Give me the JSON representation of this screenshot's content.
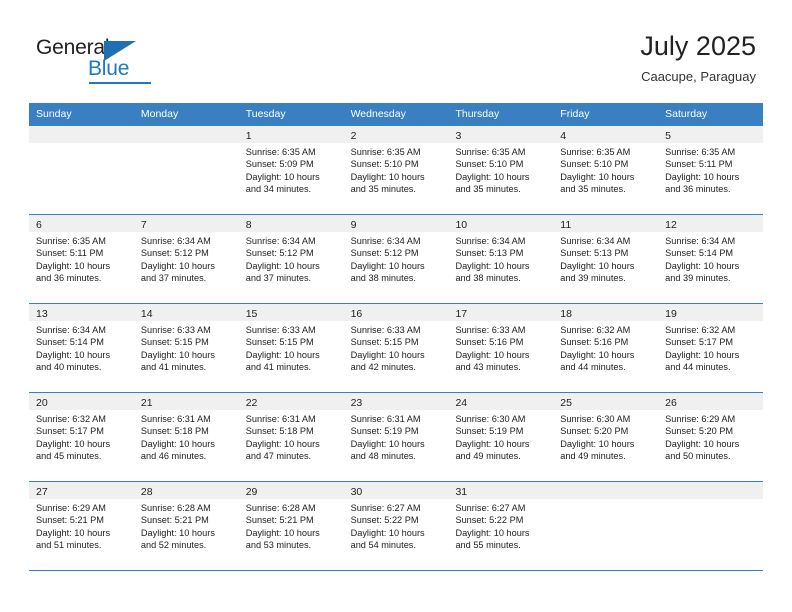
{
  "brand": {
    "name_part1": "General",
    "name_part2": "Blue",
    "triangle_icon": "triangle-icon",
    "accent_color": "#1f78c1"
  },
  "header": {
    "title": "July 2025",
    "subtitle": "Caacupe, Paraguay"
  },
  "calendar": {
    "header_bg": "#3a7fc1",
    "day_strip_bg": "#f0f0f0",
    "weekdays": [
      "Sunday",
      "Monday",
      "Tuesday",
      "Wednesday",
      "Thursday",
      "Friday",
      "Saturday"
    ],
    "weeks": [
      [
        {
          "day": "",
          "sunrise": "",
          "sunset": "",
          "daylight_line1": "",
          "daylight_line2": ""
        },
        {
          "day": "",
          "sunrise": "",
          "sunset": "",
          "daylight_line1": "",
          "daylight_line2": ""
        },
        {
          "day": "1",
          "sunrise": "Sunrise: 6:35 AM",
          "sunset": "Sunset: 5:09 PM",
          "daylight_line1": "Daylight: 10 hours",
          "daylight_line2": "and 34 minutes."
        },
        {
          "day": "2",
          "sunrise": "Sunrise: 6:35 AM",
          "sunset": "Sunset: 5:10 PM",
          "daylight_line1": "Daylight: 10 hours",
          "daylight_line2": "and 35 minutes."
        },
        {
          "day": "3",
          "sunrise": "Sunrise: 6:35 AM",
          "sunset": "Sunset: 5:10 PM",
          "daylight_line1": "Daylight: 10 hours",
          "daylight_line2": "and 35 minutes."
        },
        {
          "day": "4",
          "sunrise": "Sunrise: 6:35 AM",
          "sunset": "Sunset: 5:10 PM",
          "daylight_line1": "Daylight: 10 hours",
          "daylight_line2": "and 35 minutes."
        },
        {
          "day": "5",
          "sunrise": "Sunrise: 6:35 AM",
          "sunset": "Sunset: 5:11 PM",
          "daylight_line1": "Daylight: 10 hours",
          "daylight_line2": "and 36 minutes."
        }
      ],
      [
        {
          "day": "6",
          "sunrise": "Sunrise: 6:35 AM",
          "sunset": "Sunset: 5:11 PM",
          "daylight_line1": "Daylight: 10 hours",
          "daylight_line2": "and 36 minutes."
        },
        {
          "day": "7",
          "sunrise": "Sunrise: 6:34 AM",
          "sunset": "Sunset: 5:12 PM",
          "daylight_line1": "Daylight: 10 hours",
          "daylight_line2": "and 37 minutes."
        },
        {
          "day": "8",
          "sunrise": "Sunrise: 6:34 AM",
          "sunset": "Sunset: 5:12 PM",
          "daylight_line1": "Daylight: 10 hours",
          "daylight_line2": "and 37 minutes."
        },
        {
          "day": "9",
          "sunrise": "Sunrise: 6:34 AM",
          "sunset": "Sunset: 5:12 PM",
          "daylight_line1": "Daylight: 10 hours",
          "daylight_line2": "and 38 minutes."
        },
        {
          "day": "10",
          "sunrise": "Sunrise: 6:34 AM",
          "sunset": "Sunset: 5:13 PM",
          "daylight_line1": "Daylight: 10 hours",
          "daylight_line2": "and 38 minutes."
        },
        {
          "day": "11",
          "sunrise": "Sunrise: 6:34 AM",
          "sunset": "Sunset: 5:13 PM",
          "daylight_line1": "Daylight: 10 hours",
          "daylight_line2": "and 39 minutes."
        },
        {
          "day": "12",
          "sunrise": "Sunrise: 6:34 AM",
          "sunset": "Sunset: 5:14 PM",
          "daylight_line1": "Daylight: 10 hours",
          "daylight_line2": "and 39 minutes."
        }
      ],
      [
        {
          "day": "13",
          "sunrise": "Sunrise: 6:34 AM",
          "sunset": "Sunset: 5:14 PM",
          "daylight_line1": "Daylight: 10 hours",
          "daylight_line2": "and 40 minutes."
        },
        {
          "day": "14",
          "sunrise": "Sunrise: 6:33 AM",
          "sunset": "Sunset: 5:15 PM",
          "daylight_line1": "Daylight: 10 hours",
          "daylight_line2": "and 41 minutes."
        },
        {
          "day": "15",
          "sunrise": "Sunrise: 6:33 AM",
          "sunset": "Sunset: 5:15 PM",
          "daylight_line1": "Daylight: 10 hours",
          "daylight_line2": "and 41 minutes."
        },
        {
          "day": "16",
          "sunrise": "Sunrise: 6:33 AM",
          "sunset": "Sunset: 5:15 PM",
          "daylight_line1": "Daylight: 10 hours",
          "daylight_line2": "and 42 minutes."
        },
        {
          "day": "17",
          "sunrise": "Sunrise: 6:33 AM",
          "sunset": "Sunset: 5:16 PM",
          "daylight_line1": "Daylight: 10 hours",
          "daylight_line2": "and 43 minutes."
        },
        {
          "day": "18",
          "sunrise": "Sunrise: 6:32 AM",
          "sunset": "Sunset: 5:16 PM",
          "daylight_line1": "Daylight: 10 hours",
          "daylight_line2": "and 44 minutes."
        },
        {
          "day": "19",
          "sunrise": "Sunrise: 6:32 AM",
          "sunset": "Sunset: 5:17 PM",
          "daylight_line1": "Daylight: 10 hours",
          "daylight_line2": "and 44 minutes."
        }
      ],
      [
        {
          "day": "20",
          "sunrise": "Sunrise: 6:32 AM",
          "sunset": "Sunset: 5:17 PM",
          "daylight_line1": "Daylight: 10 hours",
          "daylight_line2": "and 45 minutes."
        },
        {
          "day": "21",
          "sunrise": "Sunrise: 6:31 AM",
          "sunset": "Sunset: 5:18 PM",
          "daylight_line1": "Daylight: 10 hours",
          "daylight_line2": "and 46 minutes."
        },
        {
          "day": "22",
          "sunrise": "Sunrise: 6:31 AM",
          "sunset": "Sunset: 5:18 PM",
          "daylight_line1": "Daylight: 10 hours",
          "daylight_line2": "and 47 minutes."
        },
        {
          "day": "23",
          "sunrise": "Sunrise: 6:31 AM",
          "sunset": "Sunset: 5:19 PM",
          "daylight_line1": "Daylight: 10 hours",
          "daylight_line2": "and 48 minutes."
        },
        {
          "day": "24",
          "sunrise": "Sunrise: 6:30 AM",
          "sunset": "Sunset: 5:19 PM",
          "daylight_line1": "Daylight: 10 hours",
          "daylight_line2": "and 49 minutes."
        },
        {
          "day": "25",
          "sunrise": "Sunrise: 6:30 AM",
          "sunset": "Sunset: 5:20 PM",
          "daylight_line1": "Daylight: 10 hours",
          "daylight_line2": "and 49 minutes."
        },
        {
          "day": "26",
          "sunrise": "Sunrise: 6:29 AM",
          "sunset": "Sunset: 5:20 PM",
          "daylight_line1": "Daylight: 10 hours",
          "daylight_line2": "and 50 minutes."
        }
      ],
      [
        {
          "day": "27",
          "sunrise": "Sunrise: 6:29 AM",
          "sunset": "Sunset: 5:21 PM",
          "daylight_line1": "Daylight: 10 hours",
          "daylight_line2": "and 51 minutes."
        },
        {
          "day": "28",
          "sunrise": "Sunrise: 6:28 AM",
          "sunset": "Sunset: 5:21 PM",
          "daylight_line1": "Daylight: 10 hours",
          "daylight_line2": "and 52 minutes."
        },
        {
          "day": "29",
          "sunrise": "Sunrise: 6:28 AM",
          "sunset": "Sunset: 5:21 PM",
          "daylight_line1": "Daylight: 10 hours",
          "daylight_line2": "and 53 minutes."
        },
        {
          "day": "30",
          "sunrise": "Sunrise: 6:27 AM",
          "sunset": "Sunset: 5:22 PM",
          "daylight_line1": "Daylight: 10 hours",
          "daylight_line2": "and 54 minutes."
        },
        {
          "day": "31",
          "sunrise": "Sunrise: 6:27 AM",
          "sunset": "Sunset: 5:22 PM",
          "daylight_line1": "Daylight: 10 hours",
          "daylight_line2": "and 55 minutes."
        },
        {
          "day": "",
          "sunrise": "",
          "sunset": "",
          "daylight_line1": "",
          "daylight_line2": ""
        },
        {
          "day": "",
          "sunrise": "",
          "sunset": "",
          "daylight_line1": "",
          "daylight_line2": ""
        }
      ]
    ]
  }
}
